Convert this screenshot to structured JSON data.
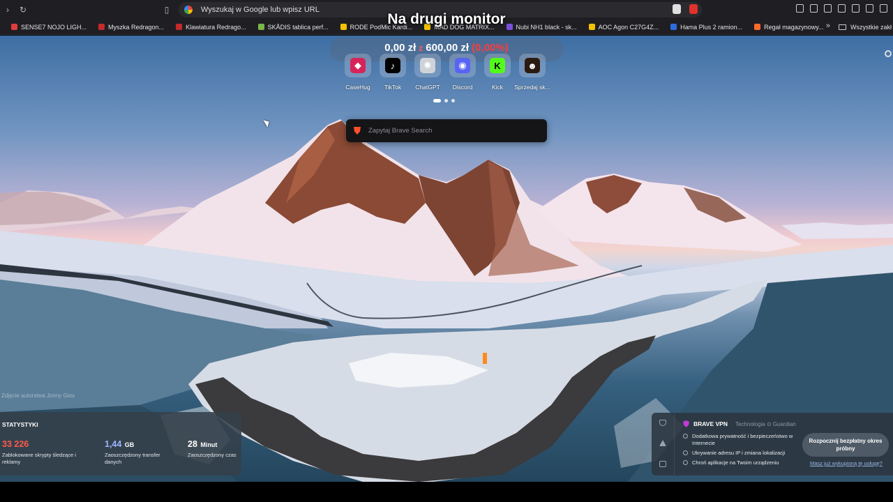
{
  "browser": {
    "url_placeholder": "Wyszukaj w Google lub wpisz URL",
    "bookmarks": [
      {
        "label": "SENSE7 NOJO LIGH...",
        "color": "#e23b3b"
      },
      {
        "label": "Myszka Redragon...",
        "color": "#c62a2a"
      },
      {
        "label": "Klawiatura Redrago...",
        "color": "#c62a2a"
      },
      {
        "label": "SKÅDIS tablica perf...",
        "color": "#7ab648"
      },
      {
        "label": "RODE PodMic Kardi...",
        "color": "#f2c200"
      },
      {
        "label": "MAD DOG MATRIX...",
        "color": "#f2c200"
      },
      {
        "label": "Nubi NH1 black - sk...",
        "color": "#7a4fd8"
      },
      {
        "label": "AOC Agon C27G4Z...",
        "color": "#f2c200"
      },
      {
        "label": "Hama Plus 2 ramion...",
        "color": "#2d6cdf"
      },
      {
        "label": "Regał magazynowy...",
        "color": "#ff6a2a"
      }
    ],
    "bookmarks_more": "»",
    "bookmarks_all": "Wszystkie zakł"
  },
  "overlay_title": "Na drugi monitor",
  "balance": {
    "current": "0,00 zł",
    "separator": "z",
    "goal": "600,00 zł",
    "percent": "(0,00%)"
  },
  "top_sites": [
    {
      "label": "CaseHug",
      "icon": "casehug-icon",
      "color": "#d6245a"
    },
    {
      "label": "TikTok",
      "icon": "tiktok-icon",
      "color": "#000000"
    },
    {
      "label": "ChatGPT",
      "icon": "chatgpt-icon",
      "color": "#cfd3d8"
    },
    {
      "label": "Discord",
      "icon": "discord-icon",
      "color": "#5865f2"
    },
    {
      "label": "Kick",
      "icon": "kick-icon",
      "color": "#53fc18"
    },
    {
      "label": "Sprzedaj sk...",
      "icon": "sprzedaj-icon",
      "color": "#2b1a10"
    }
  ],
  "search": {
    "placeholder": "Zapytaj Brave Search"
  },
  "photo_credit": "Zdjęcie autorstwa Jonny Gios",
  "stats": {
    "heading": "STATYSTYKI",
    "items": [
      {
        "value": "33 226",
        "unit": "",
        "color": "#ff5a4a",
        "desc": "Zablokowane skrypty śledzące i reklamy"
      },
      {
        "value": "1,44",
        "unit": "GB",
        "color": "#9fb4ff",
        "desc": "Zaoszczędzony transfer danych"
      },
      {
        "value": "28",
        "unit": "Minut",
        "color": "#ffffff",
        "desc": "Zaoszczędzony czas"
      }
    ]
  },
  "vpn": {
    "title": "BRAVE VPN",
    "tech": "Technologia ⊙ Guardian",
    "features": [
      "Dodatkowa prywatność i bezpieczeństwo w Internecie",
      "Ukrywanie adresu IP i zmiana lokalizacji",
      "Chroń aplikacje na Twoim urządzeniu"
    ],
    "trial_button": "Rozpocznij bezpłatny okres próbny",
    "purchased_link": "Masz już wykupioną tę usługę?"
  }
}
